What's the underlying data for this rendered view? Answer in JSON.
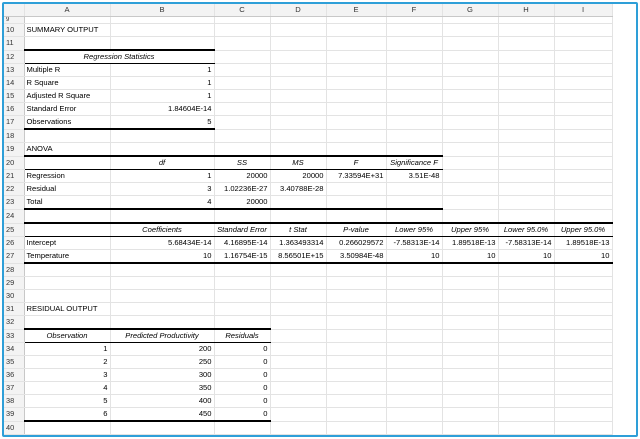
{
  "columns": [
    "A",
    "B",
    "C",
    "D",
    "E",
    "F",
    "G",
    "H",
    "I"
  ],
  "rows": {
    "r9": "9",
    "r10": "10",
    "r11": "11",
    "r12": "12",
    "r13": "13",
    "r14": "14",
    "r15": "15",
    "r16": "16",
    "r17": "17",
    "r18": "18",
    "r19": "19",
    "r20": "20",
    "r21": "21",
    "r22": "22",
    "r23": "23",
    "r24": "24",
    "r25": "25",
    "r26": "26",
    "r27": "27",
    "r28": "28",
    "r29": "29",
    "r30": "30",
    "r31": "31",
    "r32": "32",
    "r33": "33",
    "r34": "34",
    "r35": "35",
    "r36": "36",
    "r37": "37",
    "r38": "38",
    "r39": "39",
    "r40": "40"
  },
  "summary_title": "SUMMARY OUTPUT",
  "regression_stats": {
    "header": "Regression Statistics",
    "rows": [
      {
        "label": "Multiple R",
        "value": "1"
      },
      {
        "label": "R Square",
        "value": "1"
      },
      {
        "label": "Adjusted R Square",
        "value": "1"
      },
      {
        "label": "Standard Error",
        "value": "1.84604E-14"
      },
      {
        "label": "Observations",
        "value": "5"
      }
    ]
  },
  "anova": {
    "title": "ANOVA",
    "headers": [
      "df",
      "SS",
      "MS",
      "F",
      "Significance F"
    ],
    "rows": [
      {
        "label": "Regression",
        "df": "1",
        "ss": "20000",
        "ms": "20000",
        "f": "7.33594E+31",
        "sig": "3.51E-48"
      },
      {
        "label": "Residual",
        "df": "3",
        "ss": "1.02236E-27",
        "ms": "3.40788E-28",
        "f": "",
        "sig": ""
      },
      {
        "label": "Total",
        "df": "4",
        "ss": "20000",
        "ms": "",
        "f": "",
        "sig": ""
      }
    ]
  },
  "coefficients": {
    "headers": [
      "Coefficients",
      "Standard Error",
      "t Stat",
      "P-value",
      "Lower 95%",
      "Upper 95%",
      "Lower 95.0%",
      "Upper 95.0%"
    ],
    "rows": [
      {
        "label": "Intercept",
        "vals": [
          "5.68434E-14",
          "4.16895E-14",
          "1.363493314",
          "0.266029572",
          "-7.58313E-14",
          "1.89518E-13",
          "-7.58313E-14",
          "1.89518E-13"
        ]
      },
      {
        "label": "Temperature",
        "vals": [
          "10",
          "1.16754E-15",
          "8.56501E+15",
          "3.50984E-48",
          "10",
          "10",
          "10",
          "10"
        ]
      }
    ]
  },
  "residual_output": {
    "title": "RESIDUAL OUTPUT",
    "headers": [
      "Observation",
      "Predicted Productivity",
      "Residuals"
    ],
    "rows": [
      {
        "obs": "1",
        "pred": "200",
        "res": "0"
      },
      {
        "obs": "2",
        "pred": "250",
        "res": "0"
      },
      {
        "obs": "3",
        "pred": "300",
        "res": "0"
      },
      {
        "obs": "4",
        "pred": "350",
        "res": "0"
      },
      {
        "obs": "5",
        "pred": "400",
        "res": "0"
      },
      {
        "obs": "6",
        "pred": "450",
        "res": "0"
      }
    ]
  }
}
